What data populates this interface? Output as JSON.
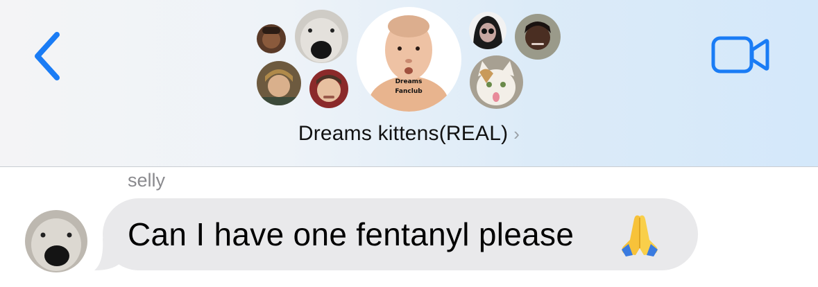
{
  "header": {
    "back_icon": "chevron-left-icon",
    "video_icon": "video-camera-icon",
    "accent_color": "#1a7cf5",
    "group_title": "Dreams kittens(REAL)",
    "chevron": "›",
    "center_avatar_shirt_line1": "Dreams",
    "center_avatar_shirt_line2": "Fanclub"
  },
  "message": {
    "sender": "selly",
    "text": "Can I have one fentanyl please",
    "emoji_icon": "folded-hands-emoji",
    "bubble_color": "#e9e9eb"
  }
}
